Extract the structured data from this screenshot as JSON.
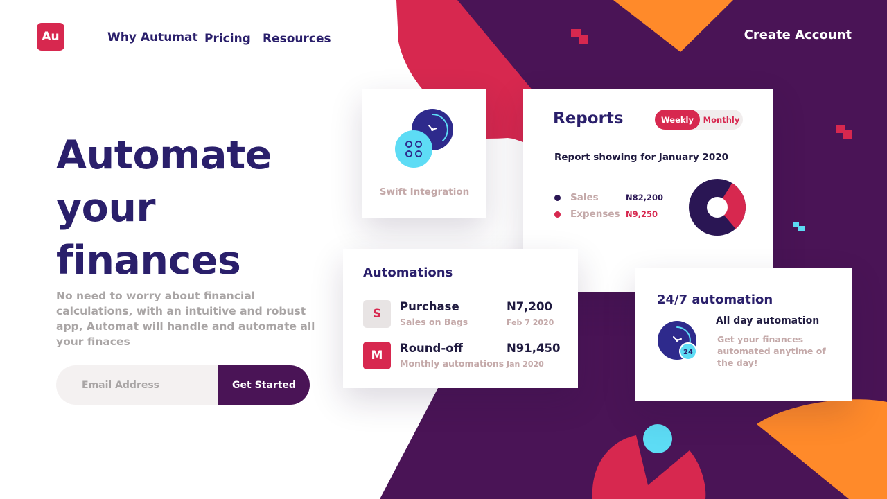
{
  "header": {
    "logo": "Au",
    "nav": [
      "Why Autumat",
      "Pricing",
      "Resources"
    ],
    "cta": "Create Account"
  },
  "hero": {
    "title_lines": [
      "Automate",
      "your",
      "finances"
    ],
    "subtitle": "No need to worry about financial calculations, with an intuitive and robust app, Automat will handle and automate all your finaces",
    "email_placeholder": "Email Address",
    "button": "Get Started"
  },
  "swift_card": {
    "label": "Swift Integration",
    "icons": [
      "clock-icon",
      "grid-dots-icon"
    ]
  },
  "reports_card": {
    "title": "Reports",
    "toggle": {
      "active": "Weekly",
      "inactive": "Monthly"
    },
    "period": "Report showing for January 2020",
    "legend": [
      {
        "name": "Sales",
        "value": "N82,200",
        "color": "#2a1654"
      },
      {
        "name": "Expenses",
        "value": "N9,250",
        "color": "#d7284f"
      }
    ],
    "donut": {
      "sales_fraction": 0.7,
      "expenses_fraction": 0.3
    }
  },
  "automations_card": {
    "title": "Automations",
    "items": [
      {
        "badge": "S",
        "name": "Purchase",
        "desc": "Sales on Bags",
        "amount": "N7,200",
        "date": "Feb 7 2020",
        "badge_bg": "#e8e4e4",
        "badge_color": "#d7284f"
      },
      {
        "badge": "M",
        "name": "Round-off",
        "desc": "Monthly automations",
        "amount": "N91,450",
        "date": "Jan 2020",
        "badge_bg": "#d7284f",
        "badge_color": "#ffffff"
      }
    ]
  },
  "automation247_card": {
    "title": "24/7 automation",
    "heading": "All day automation",
    "body": "Get your finances automated anytime of the day!",
    "icon_badge": "24"
  },
  "colors": {
    "purple_dark": "#4a1456",
    "navy": "#2a1f6b",
    "crimson": "#d7284f",
    "orange": "#ff8a2a",
    "cyan": "#5ddcf5"
  }
}
